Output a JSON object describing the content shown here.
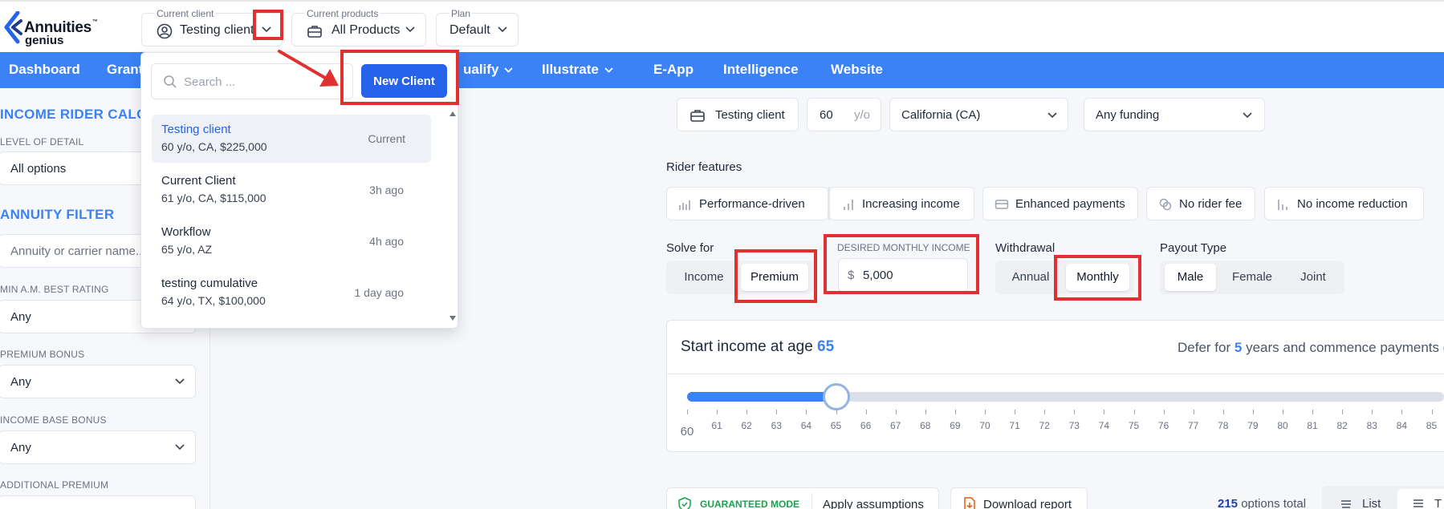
{
  "header": {
    "logo_name": "Annuities",
    "logo_tm": "™",
    "logo_sub": "genius",
    "current_client": {
      "label": "Current client",
      "value": "Testing client"
    },
    "current_products": {
      "label": "Current products",
      "value": "All Products"
    },
    "plan": {
      "label": "Plan",
      "value": "Default"
    }
  },
  "nav": {
    "items": [
      {
        "label": "Dashboard"
      },
      {
        "label": "Grant"
      },
      {
        "label": "ualify"
      },
      {
        "label": "Illustrate"
      },
      {
        "label": "E-App"
      },
      {
        "label": "Intelligence"
      },
      {
        "label": "Website"
      }
    ]
  },
  "sidebar": {
    "income_rider_title": "INCOME RIDER CALC",
    "level_of_detail_label": "LEVEL OF DETAIL",
    "level_of_detail_value": "All options",
    "annuity_filter_title": "ANNUITY FILTER",
    "annuity_search_placeholder": "Annuity or carrier name...",
    "min_rating_label": "MIN A.M. BEST RATING",
    "min_rating_value": "Any",
    "premium_bonus_label": "PREMIUM BONUS",
    "premium_bonus_value": "Any",
    "income_base_bonus_label": "INCOME BASE BONUS",
    "income_base_bonus_value": "Any",
    "additional_premium_label": "ADDITIONAL PREMIUM"
  },
  "client_dropdown": {
    "search_placeholder": "Search ...",
    "new_client_label": "New Client",
    "clients": [
      {
        "name": "Testing client",
        "details": "60 y/o, CA, $225,000",
        "time": "Current"
      },
      {
        "name": "Current Client",
        "details": "61 y/o, CA, $115,000",
        "time": "3h ago"
      },
      {
        "name": "Workflow",
        "details": "65 y/o, AZ",
        "time": "4h ago"
      },
      {
        "name": "testing cumulative",
        "details": "64 y/o, TX, $100,000",
        "time": "1 day ago"
      }
    ]
  },
  "main": {
    "client_pill": "Testing client",
    "age_value": "60",
    "age_suffix": "y/o",
    "state_value": "California (CA)",
    "funding_value": "Any funding",
    "rider_features_label": "Rider features",
    "features": [
      {
        "label": "Performance-driven"
      },
      {
        "label": "Increasing income"
      },
      {
        "label": "Enhanced payments"
      },
      {
        "label": "No rider fee"
      },
      {
        "label": "No income reduction"
      }
    ],
    "solve_for_label": "Solve for",
    "solve_for_options": [
      "Income",
      "Premium"
    ],
    "solve_for_selected": "Premium",
    "desired_income_label": "DESIRED MONTHLY INCOME",
    "desired_income_currency": "$",
    "desired_income_value": "5,000",
    "withdrawal_label": "Withdrawal",
    "withdrawal_options": [
      "Annual",
      "Monthly"
    ],
    "withdrawal_selected": "Monthly",
    "payout_type_label": "Payout Type",
    "payout_options": [
      "Male",
      "Female",
      "Joint"
    ],
    "payout_selected": "Male",
    "start_income_prefix": "Start income at age",
    "start_income_age": "65",
    "defer_prefix": "Defer for",
    "defer_years": "5",
    "defer_suffix": "years and commence payments c",
    "slider": {
      "min": 60,
      "value": 65,
      "ticks": [
        "60",
        "61",
        "62",
        "63",
        "64",
        "65",
        "66",
        "67",
        "68",
        "69",
        "70",
        "71",
        "72",
        "73",
        "74",
        "75",
        "76",
        "77",
        "78",
        "79",
        "80",
        "81",
        "82",
        "83",
        "84",
        "85"
      ]
    },
    "guaranteed_mode_label": "GUARANTEED MODE",
    "apply_assumptions_label": "Apply assumptions",
    "download_report_label": "Download report",
    "options_count": "215",
    "options_suffix": "options total",
    "view_list_label": "List",
    "view_table_label": "T"
  },
  "colors": {
    "accent": "#3b82f6",
    "button": "#2563eb",
    "annotation": "#e03131"
  }
}
